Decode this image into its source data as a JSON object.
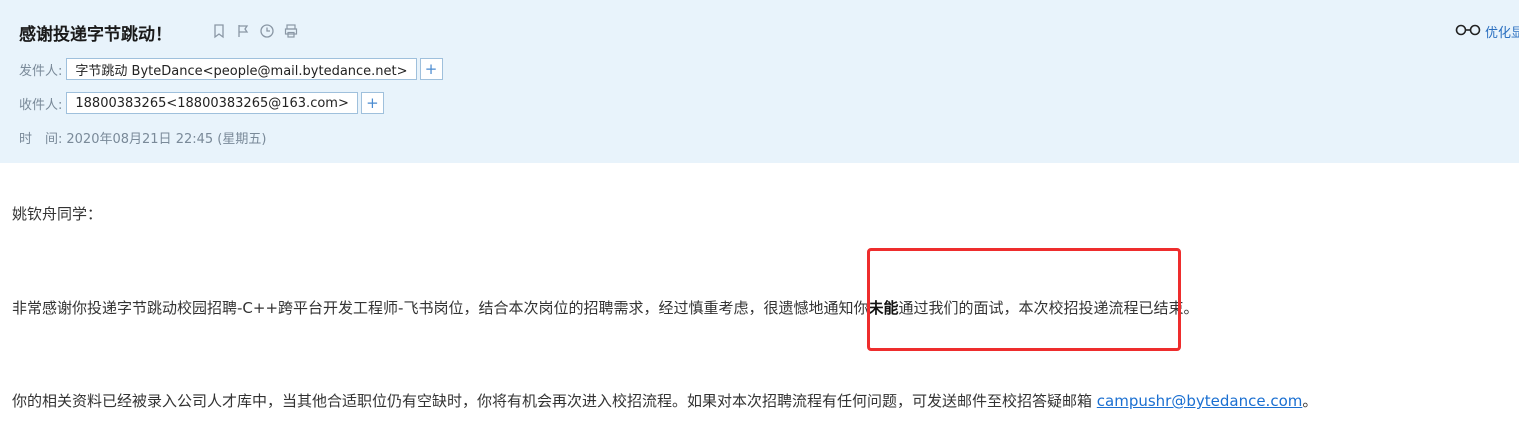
{
  "email": {
    "subject": "感谢投递字节跳动！",
    "optimize_label": "优化显示",
    "sender_label": "发件人:",
    "sender": "字节跳动 ByteDance<people@mail.bytedance.net>",
    "recipient_label": "收件人:",
    "recipient": "18800383265<18800383265@163.com>",
    "time_label": "时　间:",
    "time": "2020年08月21日 22:45 (星期五)",
    "plus": "+"
  },
  "body": {
    "greeting": "姚钦舟同学：",
    "p1_a": "非常感谢你投递字节跳动校园招聘-C++跨平台开发工程师-飞书岗位，结合本次岗位的招聘需求，经过慎重考虑，很遗憾地通知你",
    "p1_bold": "未能",
    "p1_b": "通过我们的面试，本次校招投递流程已结束。",
    "p2_a": "你的相关资料已经被录入公司人才库中，当其他合适职位仍有空缺时，你将有机会再次进入校招流程。如果对本次招聘流程有任何问题，可发送邮件至校招答疑邮箱 ",
    "p2_link": "campushr@bytedance.com",
    "p2_b": "。"
  },
  "icons": [
    "bookmark-icon",
    "flag-icon",
    "clock-icon",
    "print-icon",
    "glasses-icon"
  ],
  "colors": {
    "header_bg": "#e8f3fb",
    "highlight": "#ee2d2d",
    "link": "#1a6fd1"
  }
}
